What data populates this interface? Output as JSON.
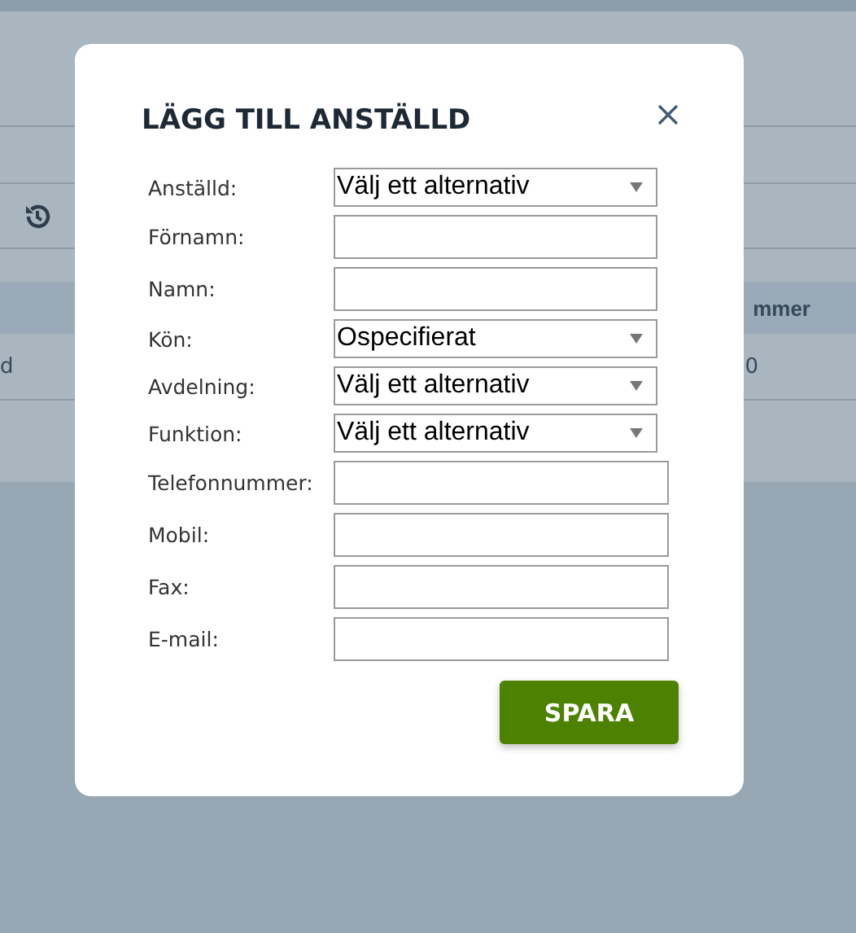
{
  "background": {
    "table": {
      "header": {
        "column_2": "mmer"
      },
      "row": {
        "column_1": "d",
        "column_2": "0"
      }
    }
  },
  "dialog": {
    "title": "LÄGG TILL ANSTÄLLD",
    "fields": [
      {
        "label": "Anställd:",
        "kind": "select",
        "value": "Välj ett alternativ"
      },
      {
        "label": "Förnamn:",
        "kind": "text"
      },
      {
        "label": "Namn:",
        "kind": "text"
      },
      {
        "label": "Kön:",
        "kind": "select",
        "value": "Ospecifierat"
      },
      {
        "label": "Avdelning:",
        "kind": "select",
        "value": "Välj ett alternativ"
      },
      {
        "label": "Funktion:",
        "kind": "select",
        "value": "Välj ett alternativ"
      },
      {
        "label": "Telefonnummer:",
        "kind": "wide"
      },
      {
        "label": "Mobil:",
        "kind": "wide"
      },
      {
        "label": "Fax:",
        "kind": "wide"
      },
      {
        "label": "E-mail:",
        "kind": "wide"
      }
    ],
    "save_button": "SPARA"
  }
}
